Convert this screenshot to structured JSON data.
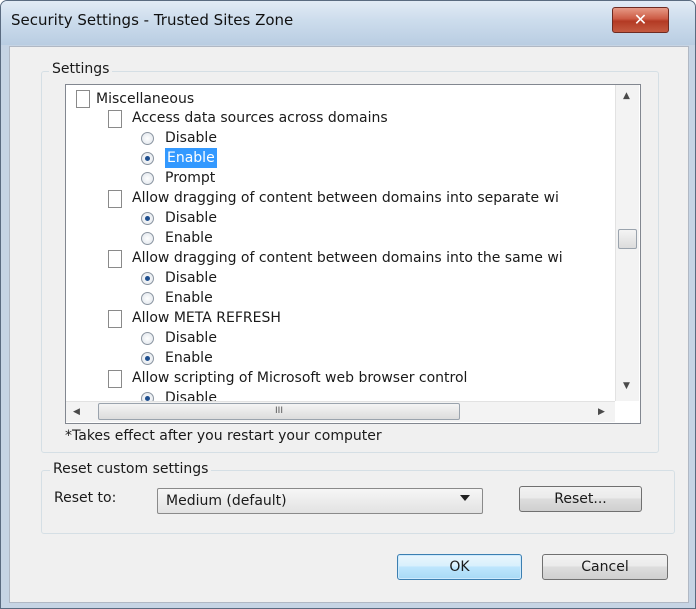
{
  "window": {
    "title": "Security Settings - Trusted Sites Zone",
    "close_glyph": "✕"
  },
  "settings_group": {
    "label": "Settings"
  },
  "tree": {
    "category": "Miscellaneous",
    "items": [
      {
        "label": "Access data sources across domains",
        "options": [
          {
            "label": "Disable",
            "checked": false
          },
          {
            "label": "Enable",
            "checked": true,
            "highlighted": true
          },
          {
            "label": "Prompt",
            "checked": false
          }
        ]
      },
      {
        "label": "Allow dragging of content between domains into separate wi",
        "options": [
          {
            "label": "Disable",
            "checked": true
          },
          {
            "label": "Enable",
            "checked": false
          }
        ]
      },
      {
        "label": "Allow dragging of content between domains into the same wi",
        "options": [
          {
            "label": "Disable",
            "checked": true
          },
          {
            "label": "Enable",
            "checked": false
          }
        ]
      },
      {
        "label": "Allow META REFRESH",
        "options": [
          {
            "label": "Disable",
            "checked": false
          },
          {
            "label": "Enable",
            "checked": true
          }
        ]
      },
      {
        "label": "Allow scripting of Microsoft web browser control",
        "options": [
          {
            "label": "Disable",
            "checked": true
          }
        ]
      }
    ]
  },
  "scroll": {
    "up": "▲",
    "down": "▼",
    "left": "◀",
    "right": "▶",
    "grip": "III"
  },
  "note": "*Takes effect after you restart your computer",
  "reset_group": {
    "label": "Reset custom settings",
    "reset_to_label": "Reset to:",
    "selected_level": "Medium (default)",
    "reset_button": "Reset..."
  },
  "buttons": {
    "ok": "OK",
    "cancel": "Cancel"
  }
}
